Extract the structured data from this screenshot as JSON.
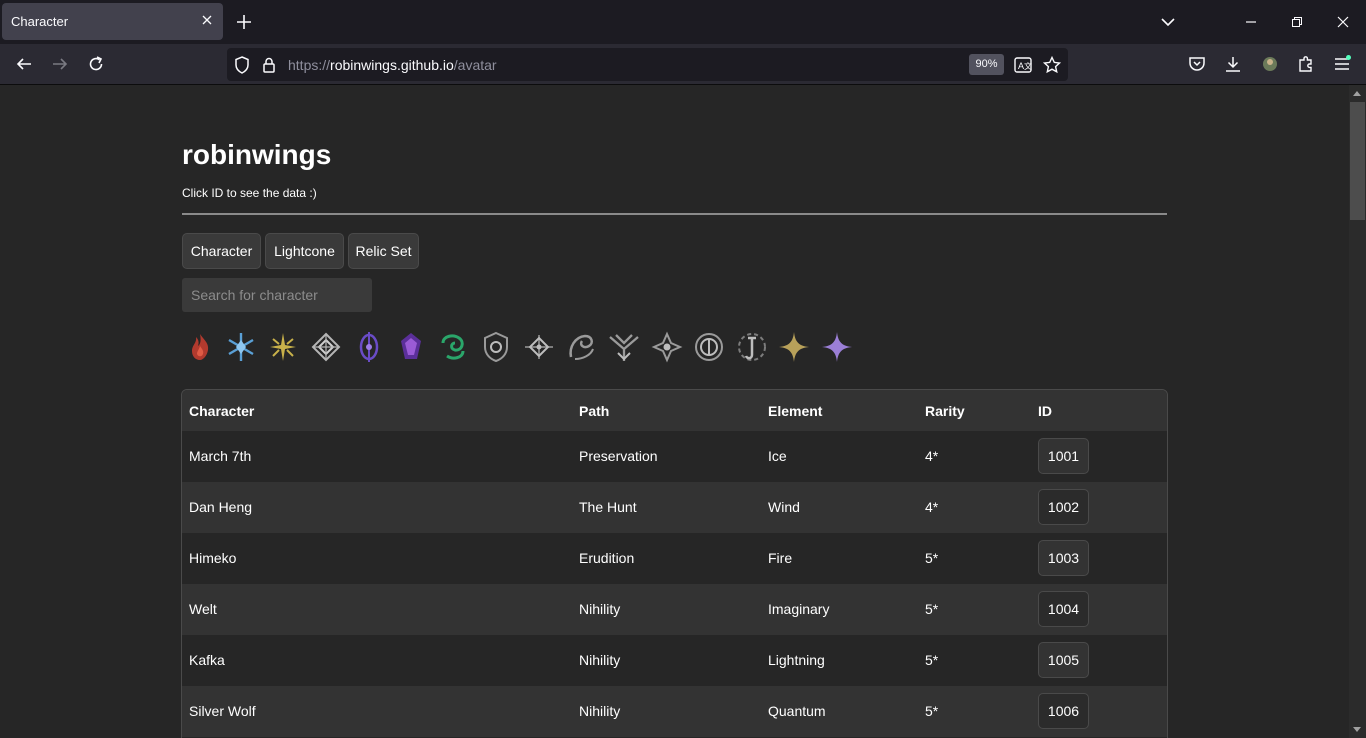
{
  "browser": {
    "tab_title": "Character",
    "url_scheme": "https://",
    "url_host": "robinwings.github.io",
    "url_path": "/avatar",
    "zoom": "90%"
  },
  "site": {
    "title": "robinwings",
    "subtitle": "Click ID to see the data :)"
  },
  "nav": [
    "Character",
    "Lightcone",
    "Relic Set"
  ],
  "search": {
    "placeholder": "Search for character"
  },
  "filters": [
    {
      "name": "fire",
      "color": "#c0392b"
    },
    {
      "name": "ice",
      "color": "#5aa0d6"
    },
    {
      "name": "wind-erudition",
      "color": "#c8b14a"
    },
    {
      "name": "imaginary-destruction",
      "color": "#b5b5b5"
    },
    {
      "name": "lightning",
      "color": "#6a4cc7"
    },
    {
      "name": "quantum",
      "color": "#8244c7"
    },
    {
      "name": "wind",
      "color": "#2aa66a"
    },
    {
      "name": "path-preservation",
      "color": "#9a9a9a"
    },
    {
      "name": "path-hunt",
      "color": "#9a9a9a"
    },
    {
      "name": "path-harmony",
      "color": "#9a9a9a"
    },
    {
      "name": "path-destruction",
      "color": "#9a9a9a"
    },
    {
      "name": "path-nihility",
      "color": "#9a9a9a"
    },
    {
      "name": "path-abundance",
      "color": "#9a9a9a"
    },
    {
      "name": "path-erudition",
      "color": "#9a9a9a"
    },
    {
      "name": "rarity-4",
      "color": "#b8a15a"
    },
    {
      "name": "rarity-5",
      "color": "#9b7fd6"
    }
  ],
  "table": {
    "headers": [
      "Character",
      "Path",
      "Element",
      "Rarity",
      "ID"
    ],
    "rows": [
      [
        "March 7th",
        "Preservation",
        "Ice",
        "4*",
        "1001"
      ],
      [
        "Dan Heng",
        "The Hunt",
        "Wind",
        "4*",
        "1002"
      ],
      [
        "Himeko",
        "Erudition",
        "Fire",
        "5*",
        "1003"
      ],
      [
        "Welt",
        "Nihility",
        "Imaginary",
        "5*",
        "1004"
      ],
      [
        "Kafka",
        "Nihility",
        "Lightning",
        "5*",
        "1005"
      ],
      [
        "Silver Wolf",
        "Nihility",
        "Quantum",
        "5*",
        "1006"
      ]
    ]
  }
}
